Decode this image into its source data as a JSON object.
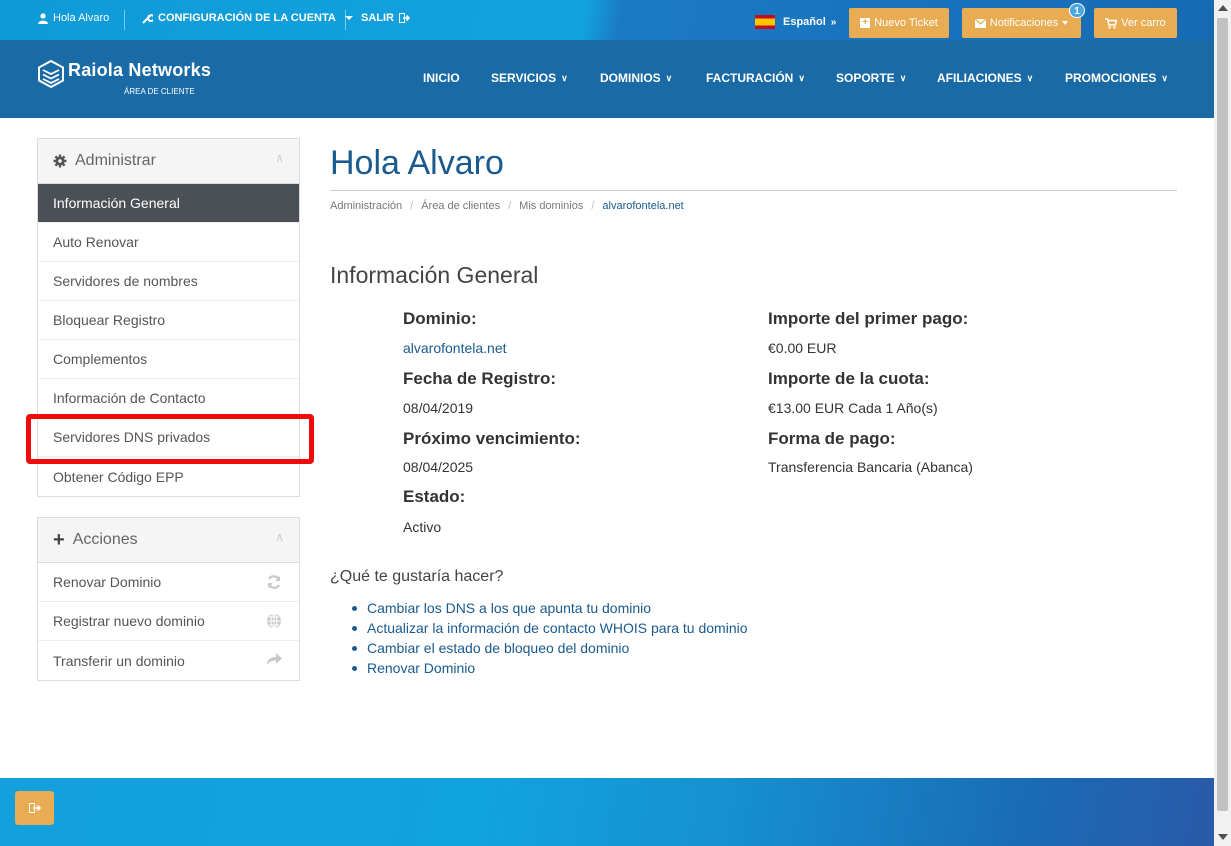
{
  "topbar": {
    "user_greeting": "Hola Alvaro",
    "account_config": "CONFIGURACIÓN DE LA CUENTA",
    "logout": "SALIR",
    "language": "Español",
    "new_ticket": "Nuevo Ticket",
    "notifications": "Notificaciones",
    "notifications_count": "1",
    "cart": "Ver carro"
  },
  "header": {
    "brand": "Raiola Networks",
    "brand_sub": "ÁREA DE CLIENTE",
    "nav": [
      "INICIO",
      "SERVICIOS",
      "DOMINIOS",
      "FACTURACIÓN",
      "SOPORTE",
      "AFILIACIONES",
      "PROMOCIONES"
    ]
  },
  "sidebar": {
    "admin_title": "Administrar",
    "admin_items": [
      "Información General",
      "Auto Renovar",
      "Servidores de nombres",
      "Bloquear Registro",
      "Complementos",
      "Información de Contacto",
      "Servidores DNS privados",
      "Obtener Código EPP"
    ],
    "actions_title": "Acciones",
    "action_items": [
      "Renovar Dominio",
      "Registrar nuevo dominio",
      "Transferir un dominio"
    ]
  },
  "main": {
    "title": "Hola Alvaro",
    "breadcrumb": [
      "Administración",
      "Área de clientes",
      "Mis dominios",
      "alvarofontela.net"
    ],
    "section_title": "Información General",
    "domain_label": "Dominio:",
    "domain_value": "alvarofontela.net",
    "reg_date_label": "Fecha de Registro:",
    "reg_date_value": "08/04/2019",
    "next_due_label": "Próximo vencimiento:",
    "next_due_value": "08/04/2025",
    "status_label": "Estado:",
    "status_value": "Activo",
    "first_payment_label": "Importe del primer pago:",
    "first_payment_value": "€0.00 EUR",
    "recurring_label": "Importe de la cuota:",
    "recurring_value": "€13.00 EUR Cada 1 Año(s)",
    "payment_method_label": "Forma de pago:",
    "payment_method_value": "Transferencia Bancaria (Abanca)",
    "actions_question": "¿Qué te gustaría hacer?",
    "actions": [
      "Cambiar los DNS a los que apunta tu dominio",
      "Actualizar la información de contacto WHOIS para tu dominio",
      "Cambiar el estado de bloqueo del dominio",
      "Renovar Dominio"
    ]
  },
  "colors": {
    "accent_orange": "#e8ac52",
    "brand_blue": "#1a6aa6",
    "link_blue": "#1a5a8e",
    "highlight_red": "#ef0b0b"
  }
}
